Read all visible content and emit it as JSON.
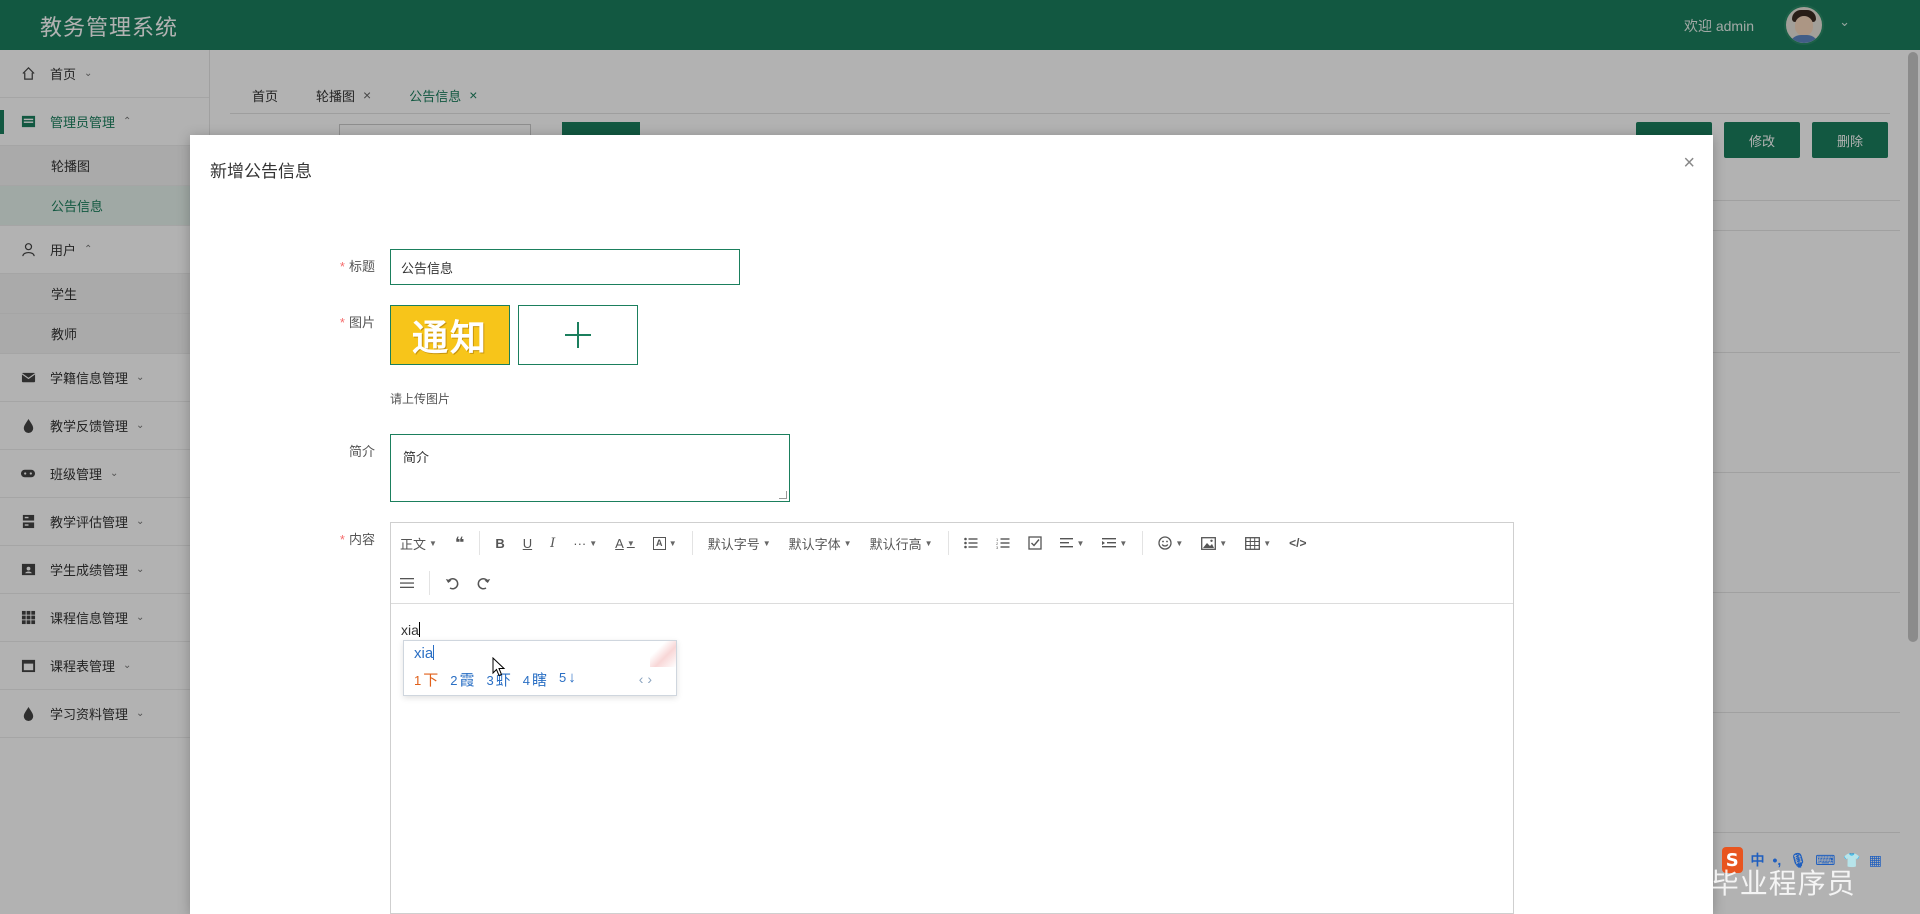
{
  "header": {
    "app_title": "教务管理系统",
    "welcome": "欢迎 admin"
  },
  "sidebar": {
    "items": [
      {
        "label": "首页",
        "icon": "home-icon",
        "expanded": false
      },
      {
        "label": "管理员管理",
        "icon": "admin-icon",
        "expanded": true,
        "children": [
          {
            "label": "轮播图"
          },
          {
            "label": "公告信息",
            "selected": true
          }
        ]
      },
      {
        "label": "用户",
        "icon": "user-icon",
        "expanded": true,
        "children": [
          {
            "label": "学生"
          },
          {
            "label": "教师"
          }
        ]
      },
      {
        "label": "学籍信息管理",
        "icon": "envelope-icon",
        "expanded": false
      },
      {
        "label": "教学反馈管理",
        "icon": "drop-icon",
        "expanded": false
      },
      {
        "label": "班级管理",
        "icon": "gamepad-icon",
        "expanded": false
      },
      {
        "label": "教学评估管理",
        "icon": "server-icon",
        "expanded": false
      },
      {
        "label": "学生成绩管理",
        "icon": "id-card-icon",
        "expanded": false
      },
      {
        "label": "课程信息管理",
        "icon": "grid-icon",
        "expanded": false
      },
      {
        "label": "课程表管理",
        "icon": "calendar-icon",
        "expanded": false
      },
      {
        "label": "学习资料管理",
        "icon": "drop-icon",
        "expanded": false
      }
    ]
  },
  "tabs": [
    {
      "label": "首页",
      "closable": false
    },
    {
      "label": "轮播图",
      "closable": true
    },
    {
      "label": "公告信息",
      "closable": true,
      "active": true
    }
  ],
  "toolbar": {
    "edit_label": "修改",
    "delete_label": "删除"
  },
  "modal": {
    "title": "新增公告信息",
    "fields": {
      "title_label": "标题",
      "title_value": "公告信息",
      "image_label": "图片",
      "image_thumb_text": "通知",
      "upload_hint": "请上传图片",
      "summary_label": "简介",
      "summary_value": "简介",
      "content_label": "内容"
    },
    "editor": {
      "toolbar": {
        "paragraph": "正文",
        "font_size": "默认字号",
        "font_family": "默认字体",
        "line_height": "默认行高"
      },
      "text": "xia"
    },
    "ime_popup": {
      "composition": "xia",
      "candidates": [
        {
          "num": "1",
          "text": "下"
        },
        {
          "num": "2",
          "text": "霞"
        },
        {
          "num": "3",
          "text": "虾"
        },
        {
          "num": "4",
          "text": "瞎"
        },
        {
          "num": "5",
          "text": "↓"
        }
      ]
    }
  },
  "ime_bar": {
    "logo": "S",
    "mode": "中"
  },
  "watermark": "CSDN @毕业程序员",
  "colors": {
    "brand": "#1b7f5d",
    "required": "#f56c6c",
    "ime_blue": "#2a6fc4",
    "ime_first": "#e0601a"
  }
}
